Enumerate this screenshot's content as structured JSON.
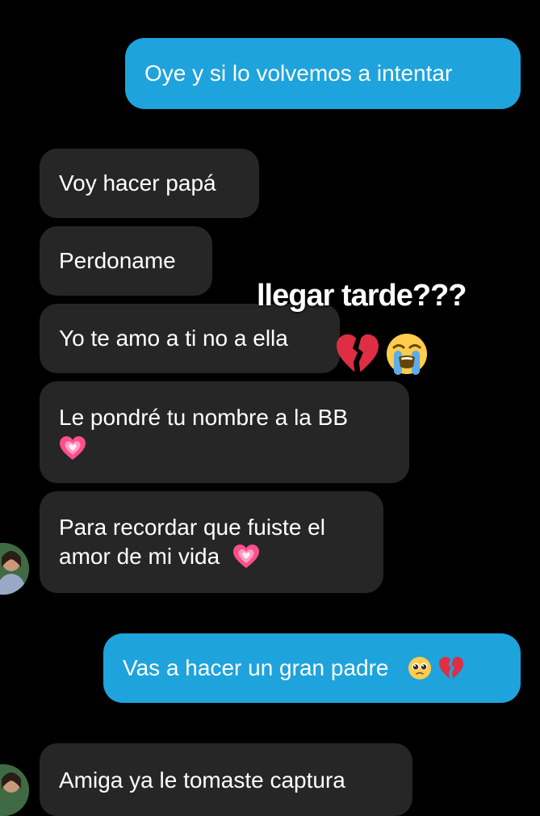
{
  "messages": {
    "m1": {
      "text": "Oye y si lo volvemos a intentar"
    },
    "m2": {
      "text": "Voy hacer papá"
    },
    "m3": {
      "text": "Perdoname"
    },
    "m4": {
      "text": "Yo te amo a ti no a ella"
    },
    "m5": {
      "line1": "Le pondré tu nombre a la BB",
      "line2_emoji": "growing-heart-emoji"
    },
    "m6": {
      "line1": "Para recordar que fuiste el",
      "line2": "amor de mi vida"
    },
    "m7": {
      "text": "Vas a hacer un gran padre"
    },
    "m8": {
      "text": "Amiga ya le tomaste captura"
    }
  },
  "overlay": {
    "caption": "llegar tarde???",
    "emojis": [
      "broken-heart-emoji",
      "loudly-crying-face-emoji"
    ]
  },
  "colors": {
    "background": "#000000",
    "sent_bubble": "#1ea3dc",
    "received_bubble": "#262626",
    "text": "#ffffff"
  }
}
